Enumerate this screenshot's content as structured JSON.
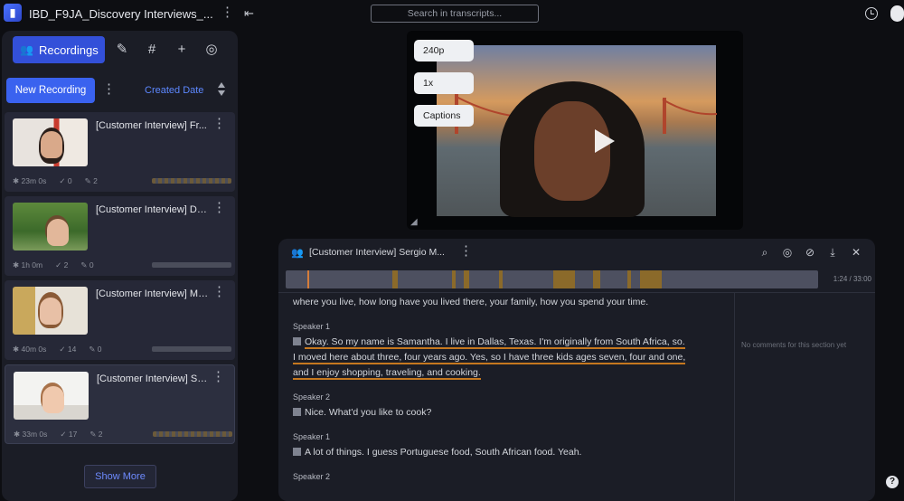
{
  "app": {
    "project_title": "IBD_F9JA_Discovery Interviews_...",
    "search_placeholder": "Search in transcripts...",
    "brand_color": "#3350d9"
  },
  "sidebar": {
    "tabs": [
      {
        "label": "Recordings",
        "icon": "people-icon",
        "active": true
      },
      {
        "icon": "highlighter-icon"
      },
      {
        "icon": "hashtag-icon"
      },
      {
        "icon": "plus-icon"
      },
      {
        "icon": "chat-icon"
      }
    ],
    "new_recording_label": "New Recording",
    "sort_label": "Created Date",
    "recordings": [
      {
        "title": "[Customer Interview] Fr...",
        "stats": [
          "23m 0s",
          "0",
          "2"
        ]
      },
      {
        "title": "[Customer Interview] Da...",
        "stats": [
          "1h 0m",
          "2",
          "0"
        ]
      },
      {
        "title": "[Customer Interview] Ma...",
        "stats": [
          "40m 0s",
          "14",
          "0"
        ]
      },
      {
        "title": "[Customer Interview] Se...",
        "stats": [
          "33m 0s",
          "17",
          "2"
        ]
      }
    ],
    "show_more_label": "Show More"
  },
  "video": {
    "options": [
      "240p",
      "1x",
      "Captions"
    ]
  },
  "transcript": {
    "title": "[Customer Interview] Sergio M...",
    "timeline_label": "1:24 / 33:00",
    "side_note": "No comments for this section yet",
    "intro_line": "where you live, how long have you lived there, your family, how you spend your time.",
    "blocks": [
      {
        "speaker": "Speaker 1",
        "lines": [
          "Okay. So my name is Samantha. I live in Dallas, Texas. I'm originally from South Africa, so.",
          "I moved here about three, four years ago. Yes, so I have three kids ages seven, four and one,",
          "and I enjoy shopping, traveling, and cooking."
        ]
      },
      {
        "speaker": "Speaker 2",
        "lines": [
          "Nice. What'd you like to cook?"
        ]
      },
      {
        "speaker": "Speaker 1",
        "lines": [
          "A lot of things. I guess Portuguese food, South African food. Yeah."
        ]
      },
      {
        "speaker": "Speaker 2",
        "lines": []
      }
    ]
  }
}
